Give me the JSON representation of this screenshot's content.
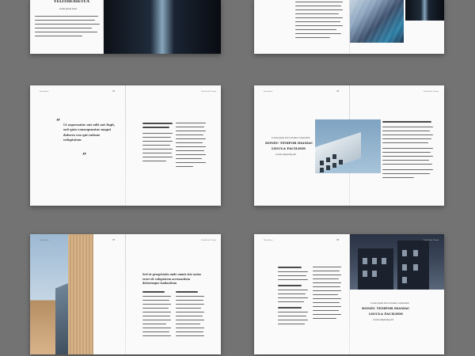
{
  "spreads": [
    {
      "id": "spread-1",
      "heading": "VELITHEASETUA",
      "sublabel": "lorem ipsum dolor"
    },
    {
      "id": "spread-2"
    },
    {
      "id": "spread-3",
      "quote": "Ut aspernatur aut odit aut fugit, sed quia consequuntur magni dolores eos qui ratione voluptatem"
    },
    {
      "id": "spread-4",
      "heading_line1": "DONEC TEMPOR DIAMAC",
      "heading_line2": "LIGULA FACILISIS",
      "kicker": "Lorem ipsum dolor sit amet consectetur",
      "byline": "Lorem adipiscing elit"
    },
    {
      "id": "spread-5",
      "lead": "Sed ut perspiciatis unde omnis iste natus error sit voluptatem accusantium doloremque laudantium"
    },
    {
      "id": "spread-6",
      "heading_line1": "DONEC TEMPOR DIAMAC",
      "heading_line2": "LIGULA FACILISIS",
      "kicker": "Lorem ipsum dolor sit amet consectetur",
      "byline": "Lorem adipiscing elit"
    }
  ],
  "page_header_left": "Brochure",
  "page_header_right": "Portfolio Name",
  "page_numbers": [
    "01",
    "02",
    "03",
    "04",
    "05",
    "06"
  ]
}
